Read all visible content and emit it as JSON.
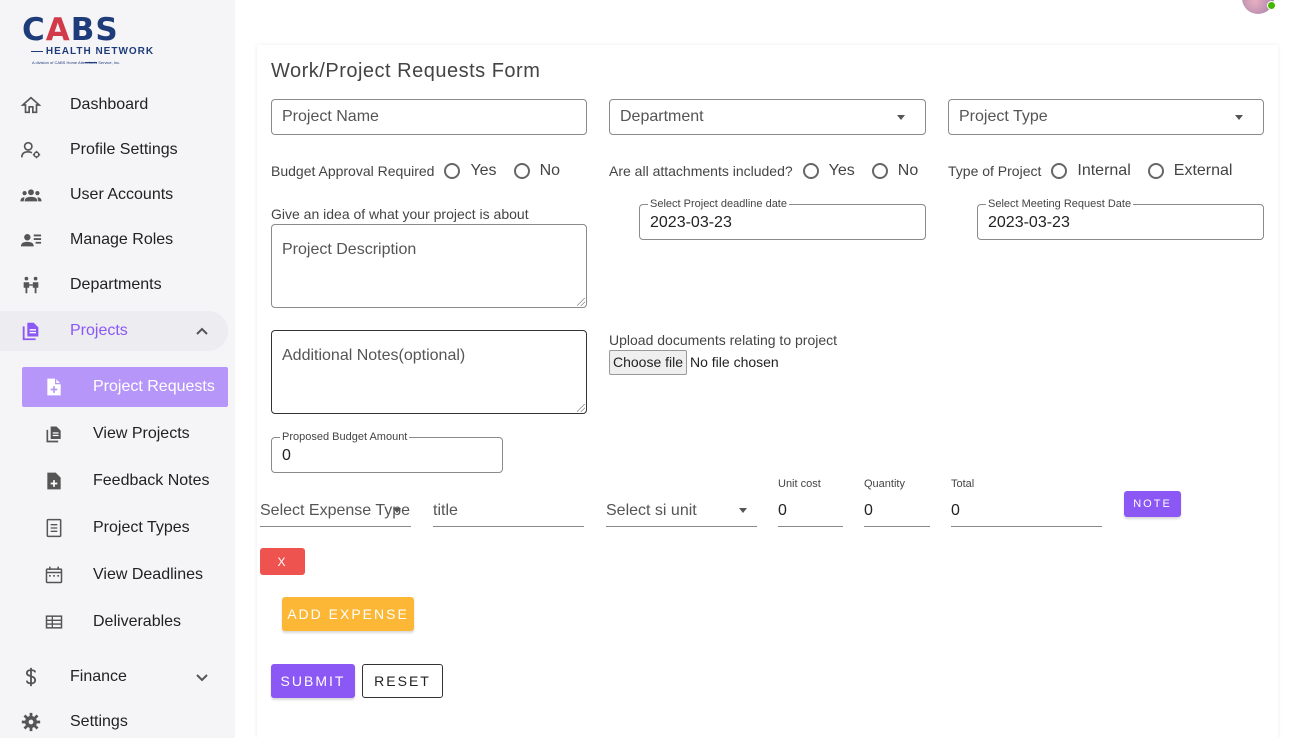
{
  "logo": {
    "main_left": "C",
    "main_o": "A",
    "main_right": "BS",
    "sub": "HEALTH NETWORK",
    "tiny": "A division of CABS Home Attendants Service, Inc."
  },
  "sidebar": {
    "items": [
      {
        "label": "Dashboard",
        "icon": "home-icon"
      },
      {
        "label": "Profile Settings",
        "icon": "user-settings-icon"
      },
      {
        "label": "User Accounts",
        "icon": "group-icon"
      },
      {
        "label": "Manage Roles",
        "icon": "manage-roles-icon"
      },
      {
        "label": "Departments",
        "icon": "departments-icon"
      },
      {
        "label": "Projects",
        "icon": "projects-icon"
      },
      {
        "label": "Finance",
        "icon": "dollar-icon"
      },
      {
        "label": "Settings",
        "icon": "gear-icon"
      }
    ],
    "project_sub_items": [
      {
        "label": "Project Requests",
        "icon": "note-add-icon"
      },
      {
        "label": "View Projects",
        "icon": "projects-icon"
      },
      {
        "label": "Feedback Notes",
        "icon": "note-add-icon"
      },
      {
        "label": "Project Types",
        "icon": "document-icon"
      },
      {
        "label": "View Deadlines",
        "icon": "calendar-icon"
      },
      {
        "label": "Deliverables",
        "icon": "table-icon"
      }
    ]
  },
  "form": {
    "title": "Work/Project Requests Form",
    "project_name_placeholder": "Project Name",
    "department_placeholder": "Department",
    "project_type_placeholder": "Project Type",
    "budget_approval": {
      "label": "Budget Approval Required",
      "options": [
        "Yes",
        "No"
      ]
    },
    "attachments": {
      "label": "Are all attachments included?",
      "options": [
        "Yes",
        "No"
      ]
    },
    "type_of_project": {
      "label": "Type of Project",
      "options": [
        "Internal",
        "External"
      ]
    },
    "description_helper": "Give an idea of what your project is about",
    "description_placeholder": "Project Description",
    "deadline": {
      "label": "Select Project deadline date",
      "value": "2023-03-23"
    },
    "meeting": {
      "label": "Select Meeting Request Date",
      "value": "2023-03-23"
    },
    "notes_placeholder": "Additional Notes(optional)",
    "upload": {
      "label": "Upload documents relating to project",
      "button": "Choose file",
      "status": "No file chosen"
    },
    "budget": {
      "label": "Proposed Budget Amount",
      "value": "0"
    },
    "expense": {
      "type_placeholder": "Select Expense Type",
      "title_placeholder": "title",
      "unit_placeholder": "Select si unit",
      "unit_cost": {
        "label": "Unit cost",
        "value": "0"
      },
      "quantity": {
        "label": "Quantity",
        "value": "0"
      },
      "total": {
        "label": "Total",
        "value": "0"
      }
    },
    "note_button": "NOTE",
    "remove_button": "X",
    "add_expense_button": "ADD EXPENSE",
    "submit_button": "SUBMIT",
    "reset_button": "RESET"
  },
  "colors": {
    "accent": "#8b57f5",
    "selected_sub": "#b796f9",
    "add_expense": "#fbb735",
    "danger": "#ef5350",
    "online": "#44b700"
  }
}
